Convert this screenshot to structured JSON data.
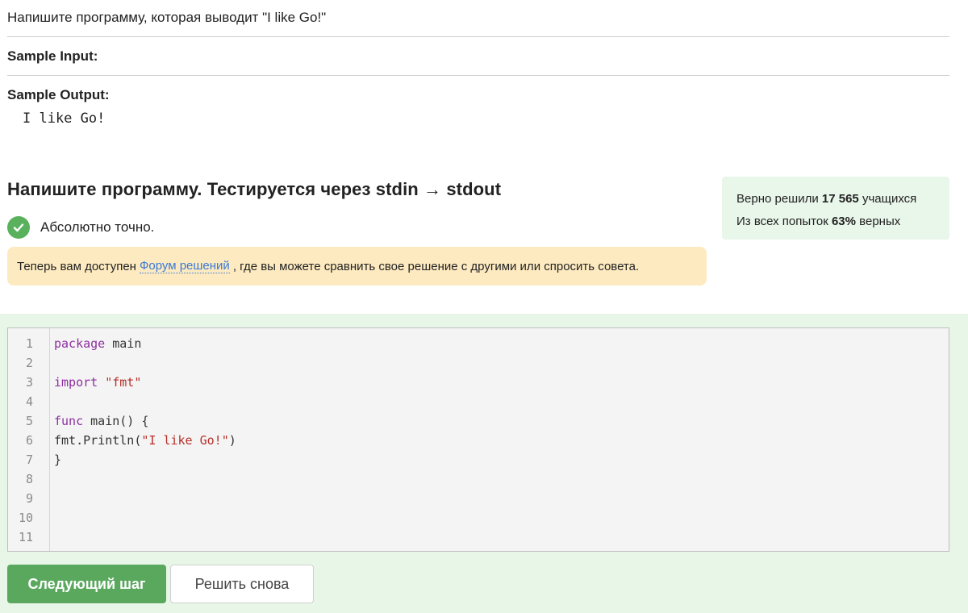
{
  "task": {
    "text": "Напишите программу, которая выводит \"I like Go!\"",
    "sample_input_label": "Sample Input:",
    "sample_output_label": "Sample Output:",
    "sample_output_value": "I like Go!"
  },
  "step": {
    "title": "Напишите программу. Тестируется через stdin → stdout",
    "status_text": "Абсолютно точно.",
    "notice_before": "Теперь вам доступен",
    "notice_link": "Форум решений",
    "notice_after": ", где вы можете сравнить свое решение с другими или спросить совета."
  },
  "stats": {
    "line1_prefix": "Верно решили",
    "line1_count": "17 565",
    "line1_suffix": "учащихся",
    "line2_prefix": "Из всех попыток",
    "line2_percent": "63%",
    "line2_suffix": "верных"
  },
  "editor": {
    "line_numbers": [
      "1",
      "2",
      "3",
      "4",
      "5",
      "6",
      "7",
      "8",
      "9",
      "10",
      "11"
    ],
    "code": {
      "l1_kw": "package",
      "l1_rest": " main",
      "l3_kw": "import",
      "l3_str": "\"fmt\"",
      "l5_kw": "func",
      "l5_rest": " main() {",
      "l6_pre": "fmt.Println(",
      "l6_str": "\"I like Go!\"",
      "l6_post": ")",
      "l7": "}"
    }
  },
  "buttons": {
    "next_label": "Следующий шаг",
    "retry_label": "Решить снова"
  },
  "colors": {
    "success_green": "#59b15d",
    "button_green": "#5aa85e",
    "notice_bg": "#fdeac0",
    "stats_bg": "#e9f6ea",
    "editor_zone_bg": "#e8f6e8",
    "link_blue": "#3a7bd5"
  }
}
